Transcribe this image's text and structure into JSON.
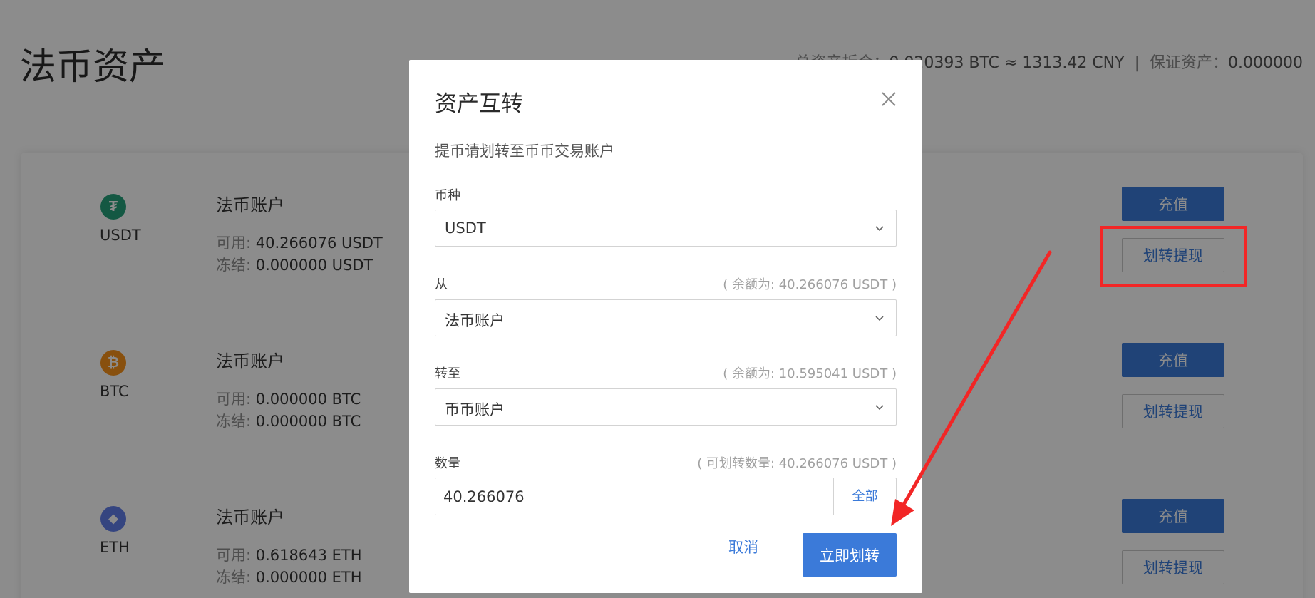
{
  "page": {
    "title": "法币资产",
    "summary": {
      "total_label": "总资产折合：",
      "total_value": "0.020393 BTC ≈ 1313.42 CNY",
      "separator": "|",
      "margin_label": "保证资产：",
      "margin_value": "0.000000"
    }
  },
  "assets": [
    {
      "symbol": "USDT",
      "icon": "tether-icon",
      "icon_glyph": "₮",
      "icon_color": "#26a17b",
      "account_name": "法币账户",
      "available_label": "可用:",
      "available_value": "40.266076 USDT",
      "frozen_label": "冻结:",
      "frozen_value": "0.000000 USDT",
      "deposit_label": "充值",
      "transfer_label": "划转提现"
    },
    {
      "symbol": "BTC",
      "icon": "bitcoin-icon",
      "icon_glyph": "₿",
      "icon_color": "#f7931a",
      "account_name": "法币账户",
      "available_label": "可用:",
      "available_value": "0.000000 BTC",
      "frozen_label": "冻结:",
      "frozen_value": "0.000000 BTC",
      "deposit_label": "充值",
      "transfer_label": "划转提现"
    },
    {
      "symbol": "ETH",
      "icon": "ethereum-icon",
      "icon_glyph": "◆",
      "icon_color": "#627eea",
      "account_name": "法币账户",
      "available_label": "可用:",
      "available_value": "0.618643 ETH",
      "frozen_label": "冻结:",
      "frozen_value": "0.000000 ETH",
      "deposit_label": "充值",
      "transfer_label": "划转提现"
    }
  ],
  "modal": {
    "title": "资产互转",
    "close_icon": "close-icon",
    "note": "提币请划转至币币交易账户",
    "currency": {
      "label": "币种",
      "value": "USDT"
    },
    "from": {
      "label": "从",
      "hint": "( 余额为:  40.266076 USDT )",
      "value": "法币账户"
    },
    "to": {
      "label": "转至",
      "hint": "( 余额为:  10.595041 USDT )",
      "value": "币币账户"
    },
    "quantity": {
      "label": "数量",
      "hint": "( 可划转数量: 40.266076 USDT )",
      "value": "40.266076",
      "all_label": "全部"
    },
    "cancel_label": "取消",
    "confirm_label": "立即划转"
  },
  "colors": {
    "accent": "#3b7ad9",
    "annotation_red": "#f22626"
  }
}
